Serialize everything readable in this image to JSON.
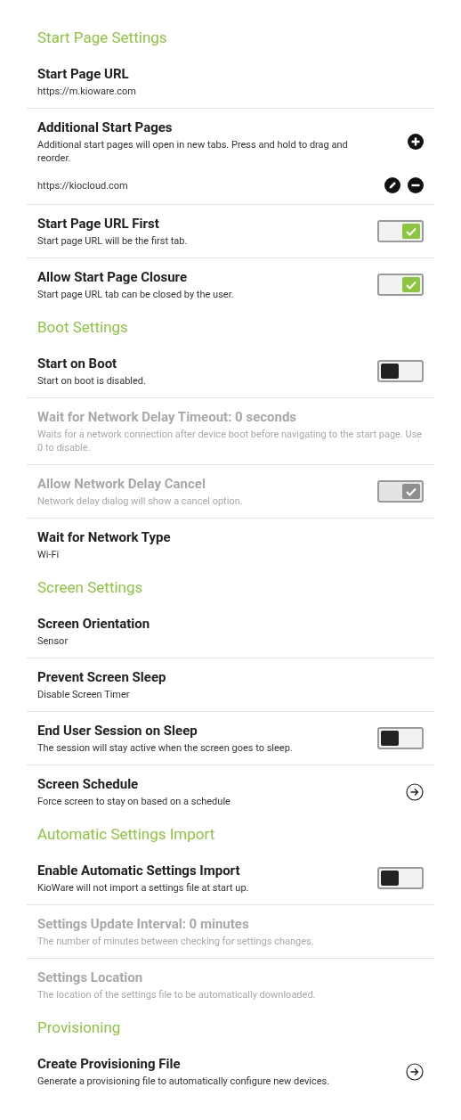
{
  "sections": [
    {
      "title": "Start Page Settings",
      "items": [
        {
          "kind": "text",
          "title": "Start Page URL",
          "subtitle": "https://m.kioware.com",
          "disabled": false
        },
        {
          "kind": "list",
          "title": "Additional Start Pages",
          "subtitle": "Additional start pages will open in new tabs. Press and hold to drag and reorder.",
          "disabled": false,
          "entries": [
            "https://kiocloud.com"
          ]
        },
        {
          "kind": "toggle",
          "title": "Start Page URL First",
          "subtitle": "Start page URL will be the first tab.",
          "disabled": false,
          "on": true
        },
        {
          "kind": "toggle",
          "title": "Allow Start Page Closure",
          "subtitle": "Start page URL tab can be closed by the user.",
          "disabled": false,
          "on": true
        }
      ]
    },
    {
      "title": "Boot Settings",
      "items": [
        {
          "kind": "toggle",
          "title": "Start on Boot",
          "subtitle": "Start on boot is disabled.",
          "disabled": false,
          "on": false
        },
        {
          "kind": "text",
          "title": "Wait for Network Delay Timeout: 0 seconds",
          "subtitle": "Waits for a network connection after device boot before navigating to the start page. Use 0 to disable.",
          "disabled": true
        },
        {
          "kind": "toggle",
          "title": "Allow Network Delay Cancel",
          "subtitle": "Network delay dialog will show a cancel option.",
          "disabled": true,
          "on": true
        },
        {
          "kind": "text",
          "title": "Wait for Network Type",
          "subtitle": "Wi-Fi",
          "disabled": false
        }
      ]
    },
    {
      "title": "Screen Settings",
      "items": [
        {
          "kind": "text",
          "title": "Screen Orientation",
          "subtitle": "Sensor",
          "disabled": false
        },
        {
          "kind": "text",
          "title": "Prevent Screen Sleep",
          "subtitle": "Disable Screen Timer",
          "disabled": false
        },
        {
          "kind": "toggle",
          "title": "End User Session on Sleep",
          "subtitle": "The session will stay active when the screen goes to sleep.",
          "disabled": false,
          "on": false
        },
        {
          "kind": "link",
          "title": "Screen Schedule",
          "subtitle": "Force screen to stay on based on a schedule",
          "disabled": false
        }
      ]
    },
    {
      "title": "Automatic Settings Import",
      "items": [
        {
          "kind": "toggle",
          "title": "Enable Automatic Settings Import",
          "subtitle": "KioWare will not import a settings file at start up.",
          "disabled": false,
          "on": false
        },
        {
          "kind": "text",
          "title": "Settings Update Interval: 0 minutes",
          "subtitle": "The number of minutes between checking for settings changes.",
          "disabled": true
        },
        {
          "kind": "text",
          "title": "Settings Location",
          "subtitle": "The location of the settings file to be automatically downloaded.",
          "disabled": true
        }
      ]
    },
    {
      "title": "Provisioning",
      "items": [
        {
          "kind": "link",
          "title": "Create Provisioning File",
          "subtitle": "Generate a provisioning file to automatically configure new devices.",
          "disabled": false
        }
      ]
    }
  ]
}
